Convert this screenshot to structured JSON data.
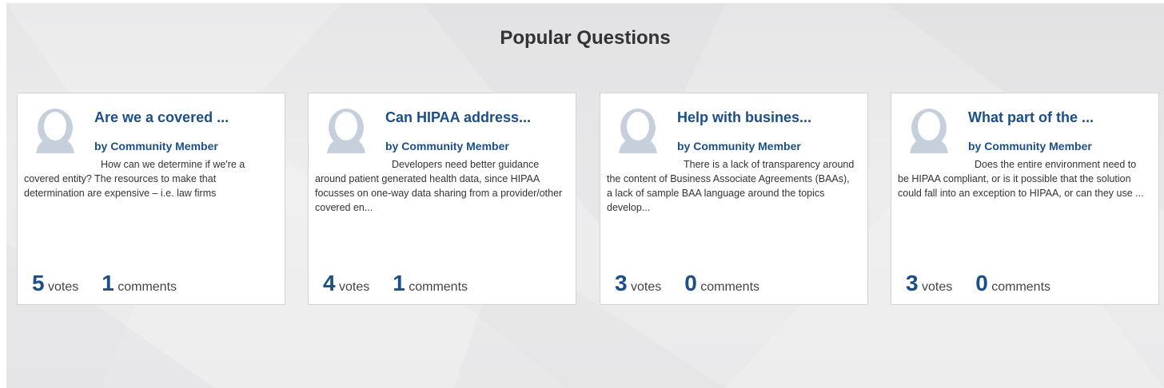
{
  "section": {
    "title": "Popular Questions"
  },
  "colors": {
    "accent": "#1b4f8a",
    "text": "#333333",
    "avatar": "#c5d0dc",
    "background": "#ebebec"
  },
  "cards": [
    {
      "title": "Are we a covered ...",
      "author": "by Community Member",
      "excerpt": "How can we determine if we're a covered entity? The resources to make that determination are expensive – i.e. law firms",
      "votes": "5",
      "votes_label": "votes",
      "comments": "1",
      "comments_label": "comments",
      "avatar_icon": "person-silhouette-icon"
    },
    {
      "title": "Can HIPAA address...",
      "author": "by Community Member",
      "excerpt": "Developers need better guidance around patient generated health data, since HIPAA focusses on one-way data sharing from a provider/other covered en...",
      "votes": "4",
      "votes_label": "votes",
      "comments": "1",
      "comments_label": "comments",
      "avatar_icon": "person-silhouette-icon"
    },
    {
      "title": "Help with busines...",
      "author": "by Community Member",
      "excerpt": "There is a lack of transparency around the content of Business Associate Agreements (BAAs), a lack of sample BAA language around the topics develop...",
      "votes": "3",
      "votes_label": "votes",
      "comments": "0",
      "comments_label": "comments",
      "avatar_icon": "person-silhouette-icon"
    },
    {
      "title": "What part of the ...",
      "author": "by Community Member",
      "excerpt": "Does the entire environment need to be HIPAA compliant, or is it possible that the solution could fall into an exception to HIPAA, or can they use ...",
      "votes": "3",
      "votes_label": "votes",
      "comments": "0",
      "comments_label": "comments",
      "avatar_icon": "person-silhouette-icon"
    }
  ]
}
